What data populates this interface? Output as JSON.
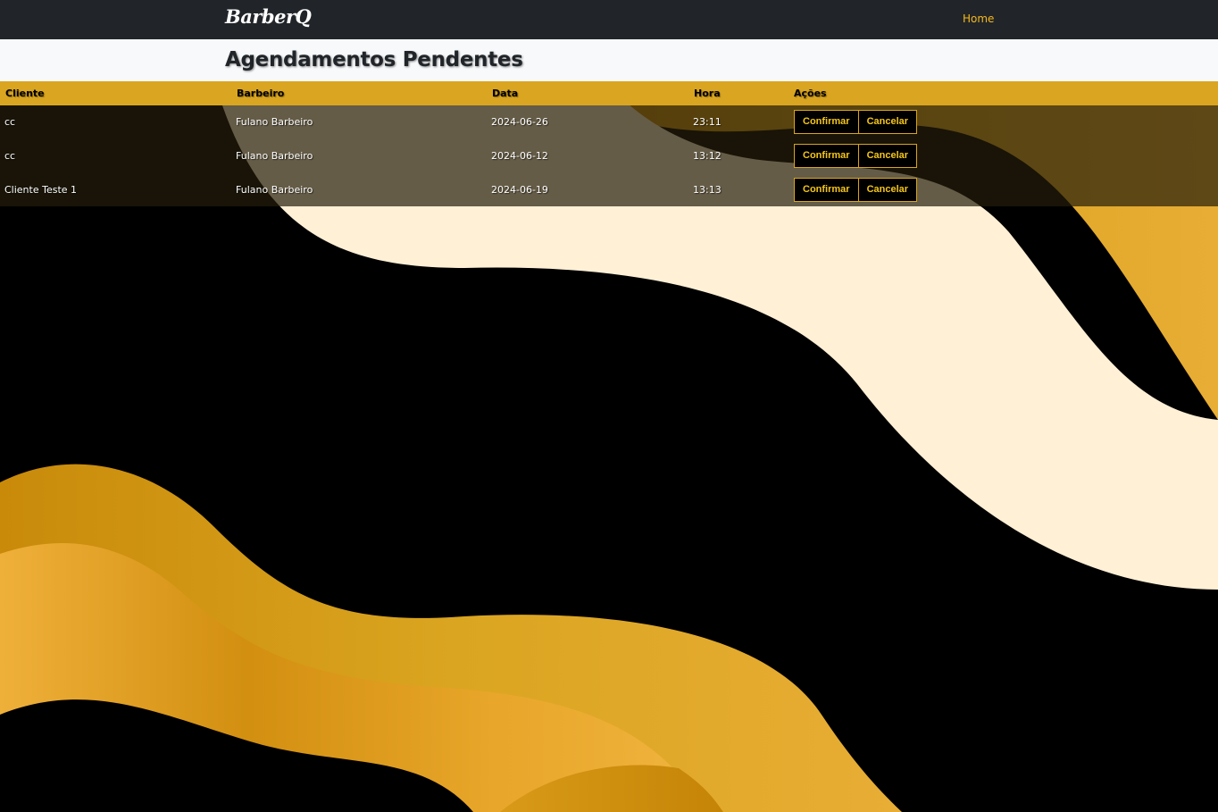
{
  "navbar": {
    "brand": "BarberQ",
    "home_label": "Home"
  },
  "page": {
    "title": "Agendamentos Pendentes"
  },
  "table": {
    "headers": {
      "cliente": "Cliente",
      "barbeiro": "Barbeiro",
      "data": "Data",
      "hora": "Hora",
      "acoes": "Ações"
    },
    "rows": [
      {
        "cliente": "cc",
        "barbeiro": "Fulano Barbeiro",
        "data": "2024-06-26",
        "hora": "23:11",
        "confirm_label": "Confirmar",
        "cancel_label": "Cancelar"
      },
      {
        "cliente": "cc",
        "barbeiro": "Fulano Barbeiro",
        "data": "2024-06-12",
        "hora": "13:12",
        "confirm_label": "Confirmar",
        "cancel_label": "Cancelar"
      },
      {
        "cliente": "Cliente Teste 1",
        "barbeiro": "Fulano Barbeiro",
        "data": "2024-06-19",
        "hora": "13:13",
        "confirm_label": "Confirmar",
        "cancel_label": "Cancelar"
      }
    ]
  },
  "colors": {
    "navbar_bg": "#212529",
    "accent_gold": "#daa520",
    "button_text": "#f5c518",
    "wave_cream": "#fff0d6",
    "page_bg": "#000000"
  }
}
